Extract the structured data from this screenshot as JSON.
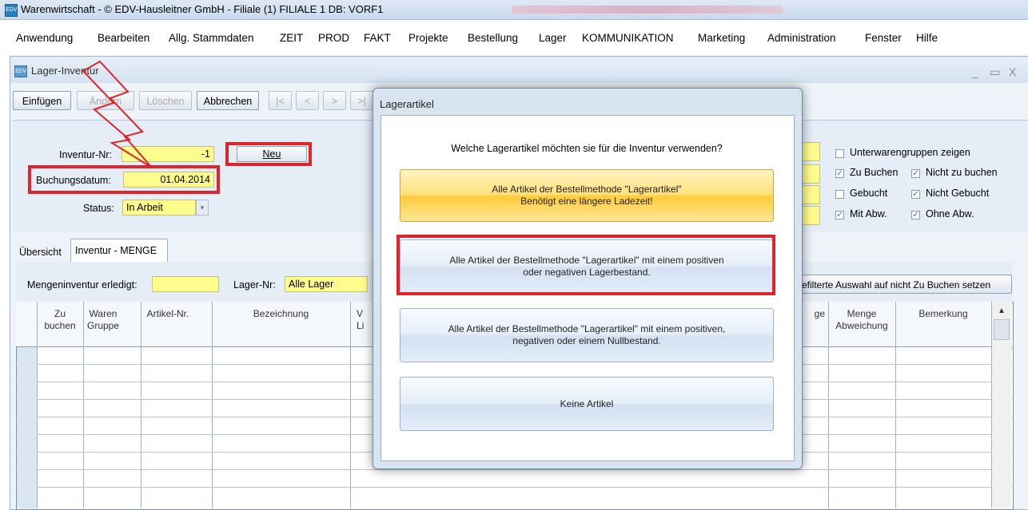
{
  "app": {
    "title": "Warenwirtschaft - © EDV-Hausleitner GmbH - Filiale (1) FILIALE 1 DB: VORF1",
    "icon": "app-icon"
  },
  "menu": {
    "items": [
      "Anwendung",
      "Bearbeiten",
      "Allg. Stammdaten",
      "ZEIT",
      "PROD",
      "FAKT",
      "Projekte",
      "Bestellung",
      "Lager",
      "KOMMUNIKATION",
      "Marketing",
      "Administration",
      "Fenster",
      "Hilfe"
    ]
  },
  "window": {
    "title": "Lager-Inventur",
    "controls": [
      "_",
      "▭",
      "X"
    ]
  },
  "toolbar": {
    "insert": "Einfügen",
    "change": "Ändern",
    "delete": "Löschen",
    "cancel": "Abbrechen",
    "first": "|<",
    "prev": "<",
    "next": ">",
    "last": ">|"
  },
  "form": {
    "inventur_nr_label": "Inventur-Nr:",
    "inventur_nr_value": "-1",
    "new_button": "Neu",
    "buchungsdatum_label": "Buchungsdatum:",
    "buchungsdatum_value": "01.04.2014",
    "status_label": "Status:",
    "status_value": "In Arbeit"
  },
  "filters": {
    "unterwarengruppen": "Unterwarengruppen zeigen",
    "zu_buchen": "Zu Buchen",
    "nicht_zu_buchen": "Nicht zu buchen",
    "gebucht": "Gebucht",
    "nicht_gebucht": "Nicht Gebucht",
    "mit_abw": "Mit Abw.",
    "ohne_abw": "Ohne Abw."
  },
  "tabs": {
    "overview": "Übersicht",
    "menge": "Inventur - MENGE"
  },
  "mengen": {
    "erledigt_label": "Mengeninventur erledigt:",
    "lager_label": "Lager-Nr:",
    "lager_value": "Alle Lager",
    "filter_button": "efilterte Auswahl auf nicht Zu Buchen setzen"
  },
  "grid": {
    "headers": {
      "zu_buchen": [
        "Zu",
        "buchen"
      ],
      "waren_gruppe": [
        "Waren",
        "Gruppe"
      ],
      "artikel_nr": "Artikel-Nr.",
      "bezeichnung": "Bezeichnung",
      "hidden_col": [
        "V",
        "Li"
      ],
      "menge_partial": "ge",
      "menge_abw": [
        "Menge",
        "Abweichung"
      ],
      "bemerkung": "Bemerkung"
    }
  },
  "dialog": {
    "title": "Lagerartikel",
    "question": "Welche Lagerartikel möchten sie für die Inventur verwenden?",
    "option1": [
      "Alle Artikel der Bestellmethode \"Lagerartikel\"",
      "Benötigt eine längere Ladezeit!"
    ],
    "option2": [
      "Alle Artikel der Bestellmethode \"Lagerartikel\" mit einem positiven",
      "oder negativen Lagerbestand."
    ],
    "option3": [
      "Alle Artikel der Bestellmethode \"Lagerartikel\" mit einem positiven,",
      "negativen oder einem Nullbestand."
    ],
    "option4": "Keine Artikel"
  },
  "colors": {
    "highlight_red": "#e0242c",
    "field_yellow": "#fffc8e",
    "window_bg": "#eef3fa"
  }
}
